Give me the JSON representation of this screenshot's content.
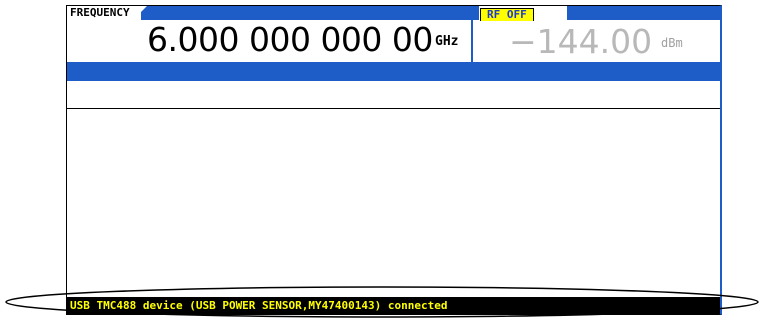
{
  "frequency": {
    "label": "FREQUENCY",
    "value": "6.000 000 000 00",
    "unit": "GHz"
  },
  "amplitude": {
    "rf_status": "RF OFF",
    "value": "−144.00",
    "unit": "dBm"
  },
  "status_bar": {
    "message": "USB TMC488 device (USB POWER SENSOR,MY47400143) connected"
  },
  "colors": {
    "accent_blue": "#1e5cc8",
    "status_bg": "#000000",
    "status_text": "#ffff00",
    "rf_off_bg": "#ffff00"
  },
  "icons": {
    "annotation": "highlight-ellipse"
  }
}
